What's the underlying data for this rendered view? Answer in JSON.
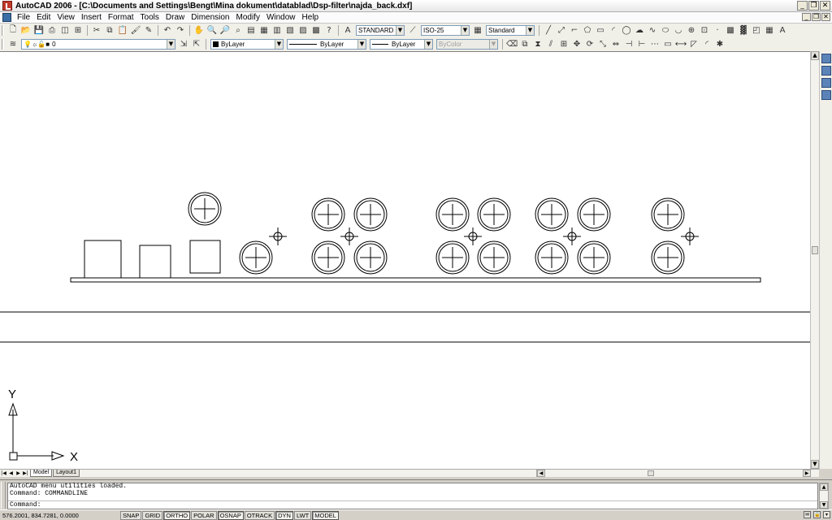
{
  "window": {
    "title": "AutoCAD 2006 - [C:\\Documents and Settings\\Bengt\\Mina dokument\\datablad\\Dsp-filter\\najda_back.dxf]",
    "minimize_glyph": "_",
    "restore_glyph": "❐",
    "close_glyph": "✕"
  },
  "menu": [
    "File",
    "Edit",
    "View",
    "Insert",
    "Format",
    "Tools",
    "Draw",
    "Dimension",
    "Modify",
    "Window",
    "Help"
  ],
  "styles_toolbar": {
    "text_style": "STANDARD",
    "dim_style": "ISO-25",
    "table_style": "Standard"
  },
  "layers_toolbar": {
    "current_layer": "0",
    "color": "ByLayer",
    "linetype": "ByLayer",
    "lineweight": "ByLayer",
    "plot_style": "ByColor"
  },
  "drawing": {
    "ucs_x_label": "X",
    "ucs_y_label": "Y"
  },
  "tabs": {
    "model": "Model",
    "layout1": "Layout1"
  },
  "command_window": {
    "history": [
      "AutoCAD menu utilities loaded.",
      "Command: COMMANDLINE"
    ],
    "prompt": "Command:"
  },
  "status": {
    "coordinates": "576.2001, 834.7281, 0.0000",
    "toggles": [
      {
        "label": "SNAP",
        "on": false
      },
      {
        "label": "GRID",
        "on": false
      },
      {
        "label": "ORTHO",
        "on": true
      },
      {
        "label": "POLAR",
        "on": false
      },
      {
        "label": "OSNAP",
        "on": true
      },
      {
        "label": "OTRACK",
        "on": false
      },
      {
        "label": "DYN",
        "on": true
      },
      {
        "label": "LWT",
        "on": false
      },
      {
        "label": "MODEL",
        "on": true
      }
    ]
  }
}
